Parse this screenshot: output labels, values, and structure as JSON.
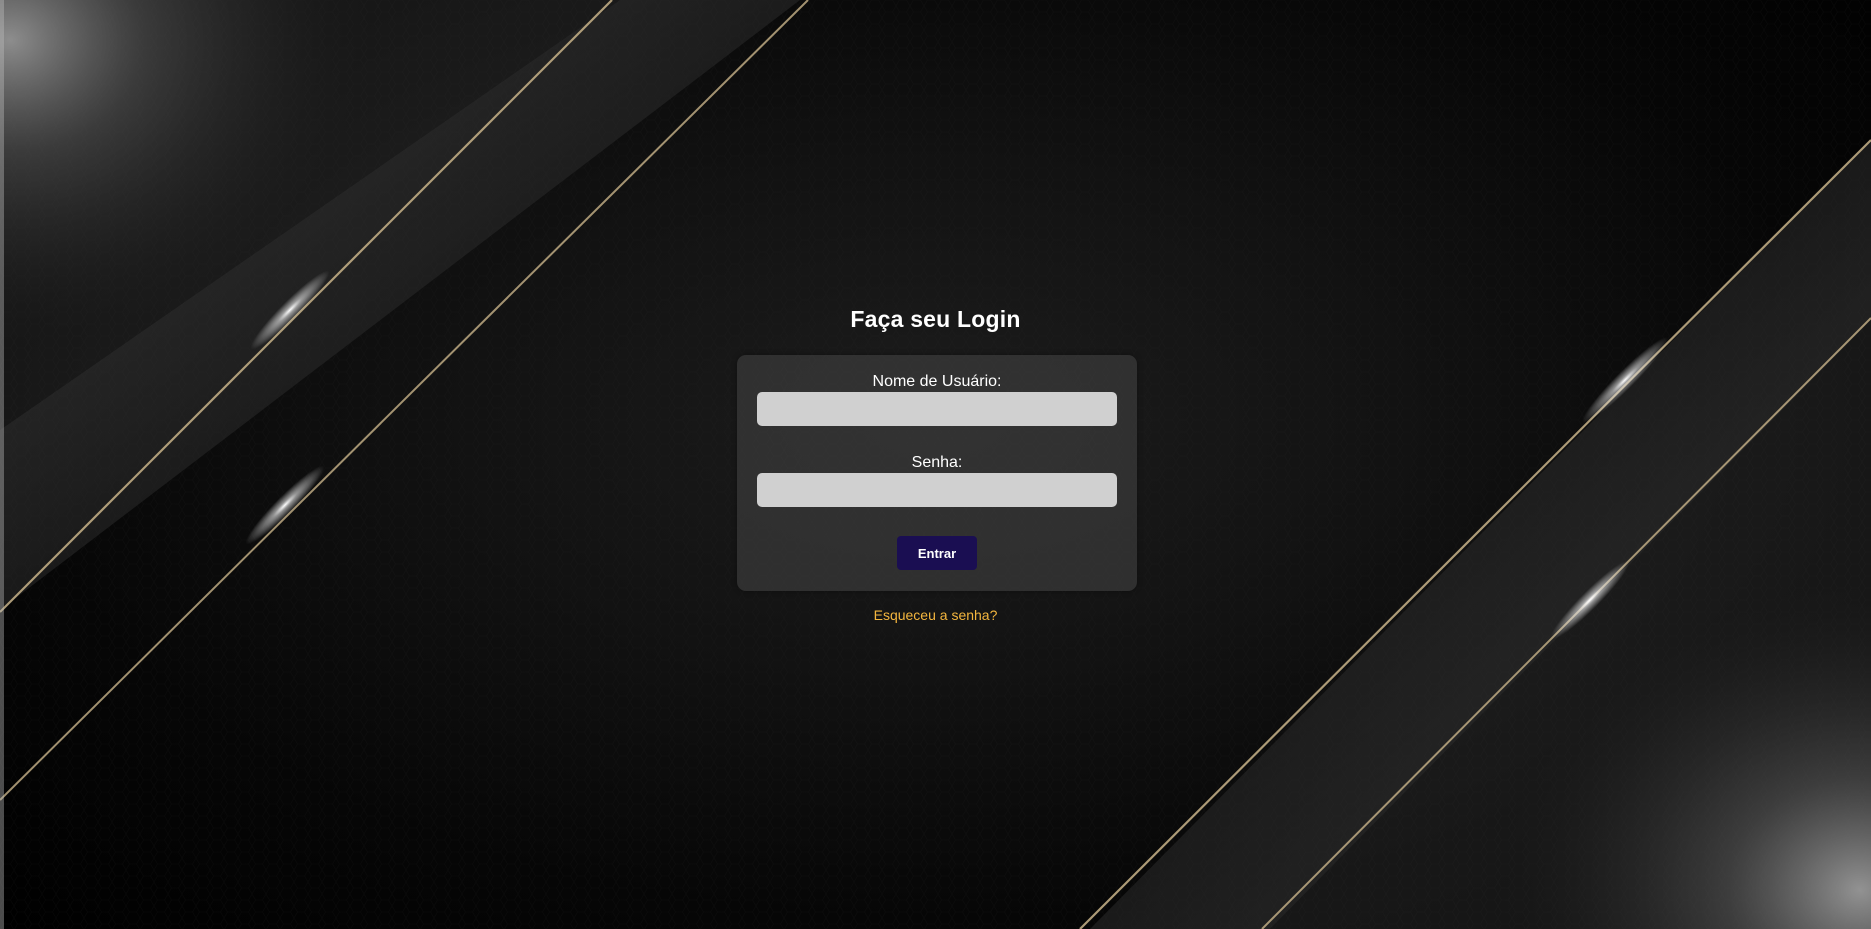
{
  "login": {
    "title": "Faça seu Login",
    "username_label": "Nome de Usuário:",
    "username_value": "",
    "password_label": "Senha:",
    "password_value": "",
    "submit_label": "Entrar",
    "forgot_label": "Esqueceu a senha?"
  },
  "colors": {
    "background": "#000000",
    "card": "#464646",
    "input": "#d0d0d0",
    "button": "#1a0e52",
    "link": "#f4b63e",
    "text": "#ffffff"
  }
}
